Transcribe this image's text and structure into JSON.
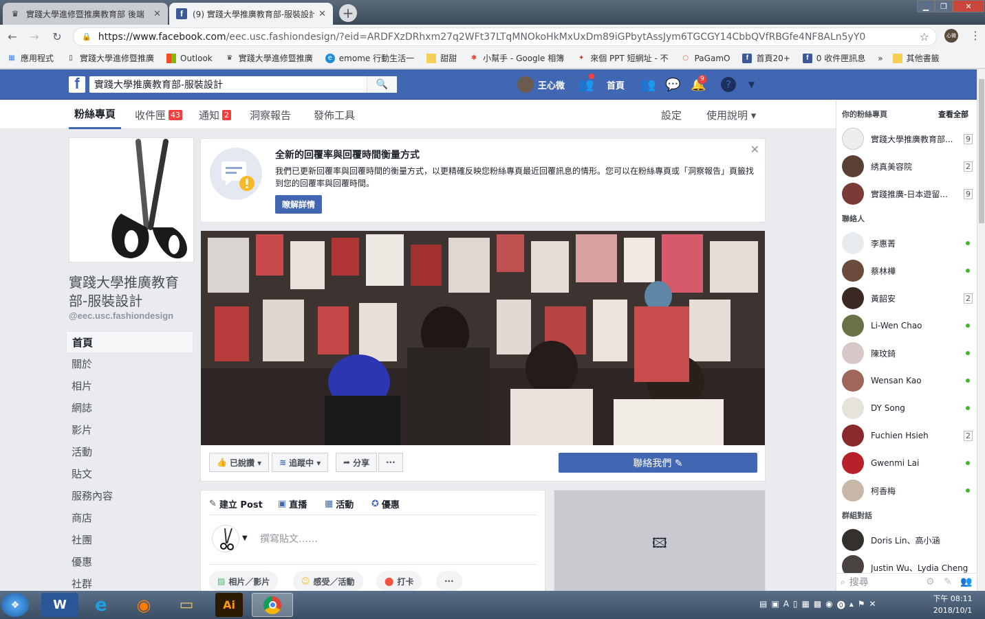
{
  "browser": {
    "tabs": [
      {
        "title": "實踐大學進修暨推廣教育部 後端",
        "active": false
      },
      {
        "title": "(9) 實踐大學推廣教育部-服裝設計",
        "active": true
      }
    ],
    "url_host": "https://www.facebook.com",
    "url_path": "/eec.usc.fashiondesign/?eid=ARDFXzDRhxm27q2WFt37LTqMNOkoHkMxUxDm89iGPbytAssJym6TGCGY14CbbQVfRBGfe4NF8ALn5yY0",
    "profile_label": "心微",
    "bookmarks": [
      "應用程式",
      "實踐大學進修暨推廣",
      "Outlook",
      "實踐大學進修暨推廣",
      "emome 行動生活一",
      "甜甜",
      "小幫手 - Google 相簿",
      "來個 PPT 短網址 - 不",
      "PaGamO",
      "首頁20+",
      "0 收件匣訊息",
      "»",
      "其他書籤"
    ]
  },
  "fb": {
    "search_value": "實踐大學推廣教育部-服裝設計",
    "user_name": "王心微",
    "home_label": "首頁",
    "notif_count": "9"
  },
  "page_tabs": [
    {
      "label": "粉絲專頁",
      "count": ""
    },
    {
      "label": "收件匣",
      "count": "43"
    },
    {
      "label": "通知",
      "count": "2"
    },
    {
      "label": "洞察報告",
      "count": ""
    },
    {
      "label": "發佈工具",
      "count": ""
    }
  ],
  "page_tabs_right": {
    "settings": "設定",
    "help": "使用說明 ▾"
  },
  "page": {
    "name": "實踐大學推廣教育部-服裝設計",
    "handle": "@eec.usc.fashiondesign"
  },
  "left_nav": [
    "首頁",
    "關於",
    "相片",
    "網誌",
    "影片",
    "活動",
    "貼文",
    "服務內容",
    "商店",
    "社團",
    "優惠",
    "社群"
  ],
  "notice": {
    "title": "全新的回覆率與回覆時間衡量方式",
    "body": "我們已更新回覆率與回覆時間的衡量方式，以更精確反映您粉絲專頁最近回覆訊息的情形。您可以在粉絲專頁或「洞察報告」頁籤找到您的回覆率與回覆時間。",
    "button": "瞭解詳情"
  },
  "actions": {
    "liked": "已說讚 ▾",
    "following": "追蹤中 ▾",
    "share": "分享",
    "more": "···",
    "contact": "聯絡我們 ✎"
  },
  "composer": {
    "tabs": [
      "建立 Post",
      "直播",
      "活動",
      "優惠"
    ],
    "placeholder": "撰寫貼文……",
    "pills": [
      "相片／影片",
      "感受／活動",
      "打卡",
      "···"
    ]
  },
  "sidebar": {
    "pages_header": "你的粉絲專頁",
    "see_all": "查看全部",
    "pages": [
      {
        "name": "實踐大學推廣教育部...",
        "count": "9"
      },
      {
        "name": "綉真美容院",
        "count": "2"
      },
      {
        "name": "實踐推廣-日本遊留...",
        "count": "9"
      }
    ],
    "contacts_header": "聯絡人",
    "contacts": [
      {
        "name": "李惠菁",
        "status": "online"
      },
      {
        "name": "蔡林樺",
        "status": "online"
      },
      {
        "name": "黃韶安",
        "status": "2"
      },
      {
        "name": "Li-Wen Chao",
        "status": "online"
      },
      {
        "name": "陳玟錡",
        "status": "online"
      },
      {
        "name": "Wensan Kao",
        "status": "online"
      },
      {
        "name": "DY Song",
        "status": "online"
      },
      {
        "name": "Fuchien Hsieh",
        "status": "2"
      },
      {
        "name": "Gwenmi Lai",
        "status": "online"
      },
      {
        "name": "柯香梅",
        "status": "online"
      }
    ],
    "groups_header": "群組對話",
    "groups": [
      "Doris Lin、高小涵",
      "Justin Wu、Lydia Cheng"
    ],
    "search_placeholder": "搜尋"
  },
  "taskbar": {
    "time": "下午 08:11",
    "date": "2018/10/1"
  },
  "colors": {
    "fb_blue": "#4267b2",
    "badge_red": "#fa3e3e",
    "online_green": "#42b72a"
  }
}
